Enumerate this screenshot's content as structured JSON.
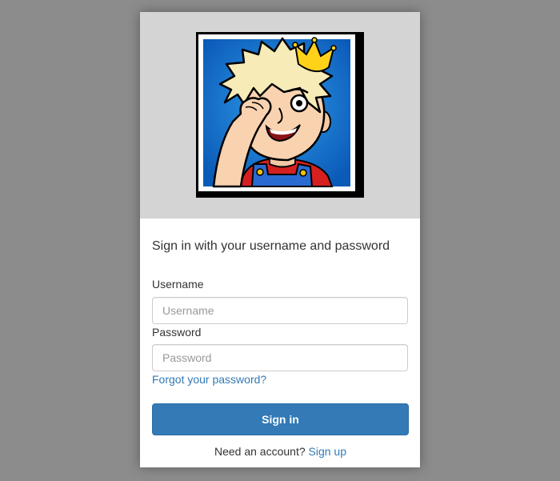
{
  "login": {
    "logo_name": "avatar-logo",
    "heading": "Sign in with your username and password",
    "username_label": "Username",
    "username_placeholder": "Username",
    "password_label": "Password",
    "password_placeholder": "Password",
    "forgot_link": "Forgot your password?",
    "signin_button": "Sign in",
    "signup_prompt": "Need an account?",
    "signup_link": "Sign up"
  },
  "colors": {
    "page_background": "#8c8c8c",
    "banner_background": "#d4d4d4",
    "primary": "#337ab7",
    "link": "#337ab7"
  }
}
